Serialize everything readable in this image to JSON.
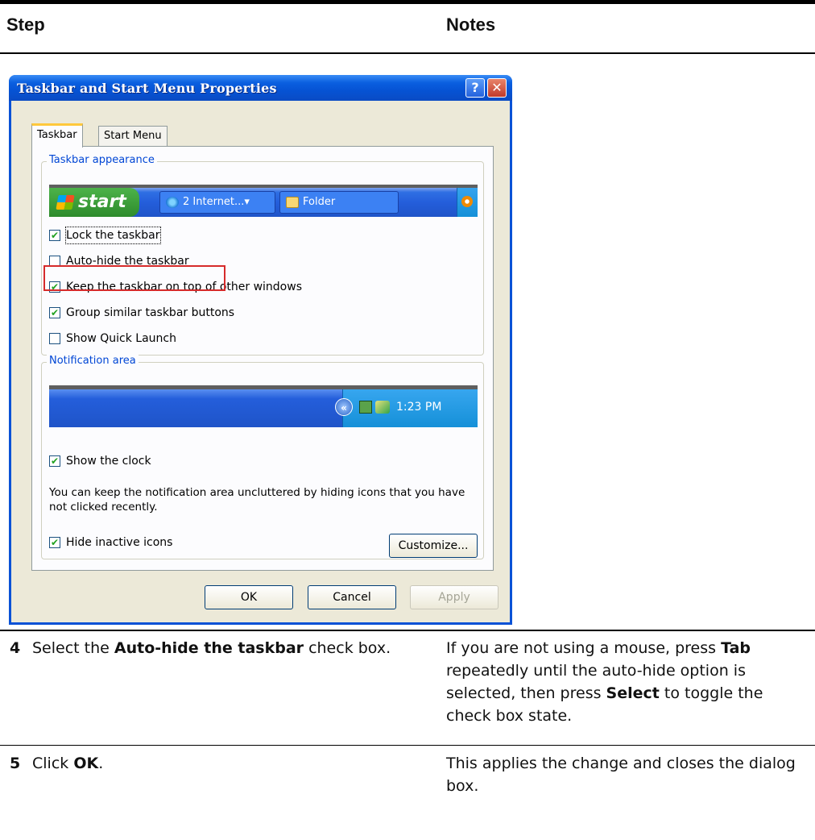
{
  "header": {
    "step_label": "Step",
    "notes_label": "Notes"
  },
  "dialog": {
    "title": "Taskbar and Start Menu Properties",
    "help_glyph": "?",
    "close_glyph": "✕",
    "tabs": [
      {
        "label": "Taskbar",
        "active": true
      },
      {
        "label": "Start Menu",
        "active": false
      }
    ],
    "taskbar_appearance": {
      "legend": "Taskbar appearance",
      "preview": {
        "start_label": "start",
        "task_buttons": [
          "2 Internet...▾",
          "Folder"
        ]
      },
      "options": [
        {
          "label": "Lock the taskbar",
          "checked": true,
          "mnemonic": "L"
        },
        {
          "label": "Auto-hide the taskbar",
          "checked": false,
          "mnemonic": "u"
        },
        {
          "label": "Keep the taskbar on top of other windows",
          "checked": true,
          "mnemonic": "t"
        },
        {
          "label": "Group similar taskbar buttons",
          "checked": true,
          "mnemonic": "G"
        },
        {
          "label": "Show Quick Launch",
          "checked": false,
          "mnemonic": "Q"
        }
      ]
    },
    "notification_area": {
      "legend": "Notification area",
      "clock_time": "1:23 PM",
      "show_clock": {
        "label": "Show the clock",
        "checked": true
      },
      "description": "You can keep the notification area uncluttered by hiding icons that you have not clicked recently.",
      "hide_inactive": {
        "label": "Hide inactive icons",
        "checked": true
      },
      "customize_label": "Customize..."
    },
    "buttons": {
      "ok": "OK",
      "cancel": "Cancel",
      "apply": "Apply"
    }
  },
  "steps": [
    {
      "number": "4",
      "text_prefix": "Select the ",
      "text_bold": "Auto-hide the taskbar",
      "text_suffix": " check box.",
      "notes_prefix": "If you are not using a mouse, press ",
      "notes_bold1": "Tab",
      "notes_middle": " repeatedly until the auto-hide option is selected, then press ",
      "notes_bold2": "Select",
      "notes_suffix": " to toggle the check box state."
    },
    {
      "number": "5",
      "text_prefix": "Click ",
      "text_bold": "OK",
      "text_suffix": ".",
      "notes": "This applies the change and closes the dialog box."
    }
  ],
  "colors": {
    "title_blue": "#0a52d6",
    "highlight_red": "#d62b2b",
    "xp_face": "#ece9d8"
  }
}
